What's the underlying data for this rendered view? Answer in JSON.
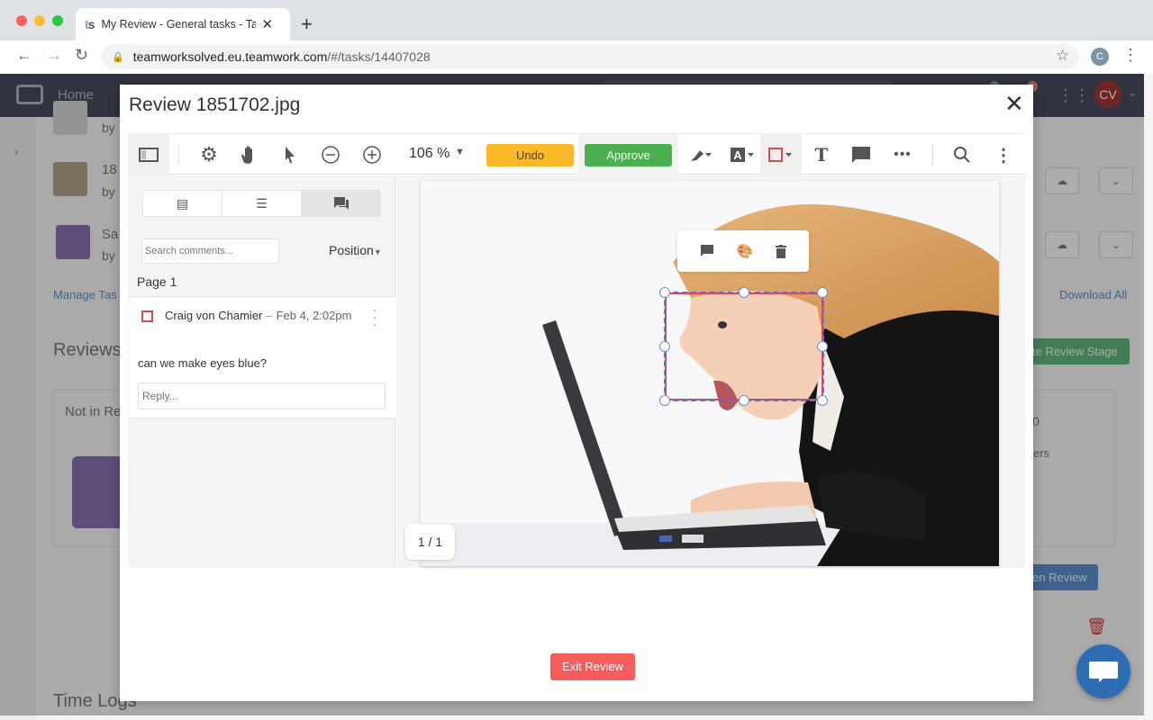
{
  "browser": {
    "tab_title": "My Review - General tasks - Tasks",
    "favicon": "ts",
    "url_host": "teamworksolved.eu.teamwork.com",
    "url_path": "/#/tasks/14407028",
    "profile_initial": "C"
  },
  "app": {
    "nav_home": "Home",
    "user_initials": "CV",
    "background": {
      "files": [
        {
          "name": "",
          "by": "by"
        },
        {
          "name": "18",
          "by": "by"
        },
        {
          "name": "Sa",
          "by": "by"
        }
      ],
      "manage_link": "Manage Tas",
      "download_all": "Download All",
      "reviews_heading": "Reviews",
      "not_in_review": "Not in Re",
      "review_stage_button": "te Review Stage",
      "members_text": "ers",
      "open_review_button": "en Review",
      "time_logs": "Time Logs",
      "date_value": "0"
    }
  },
  "modal": {
    "title": "Review 1851702.jpg",
    "toolbar": {
      "zoom_value": "106 %",
      "undo_label": "Undo",
      "approve_label": "Approve",
      "tooltip": "Approve"
    },
    "sidebar": {
      "search_placeholder": "Search comments...",
      "sort_label": "Position",
      "page_label": "Page 1",
      "comments": [
        {
          "author": "Craig von Chamier",
          "separator": "–",
          "date": "Feb 4, 2:02pm",
          "text": "can we make eyes blue?",
          "reply_placeholder": "Reply..."
        }
      ]
    },
    "pager": "1 / 1",
    "exit_label": "Exit Review"
  },
  "colors": {
    "undo": "#fbb829",
    "approve": "#4caf50",
    "exit": "#f55d5d",
    "annotation": "#e04848",
    "nav_bg": "#1b1d35"
  }
}
